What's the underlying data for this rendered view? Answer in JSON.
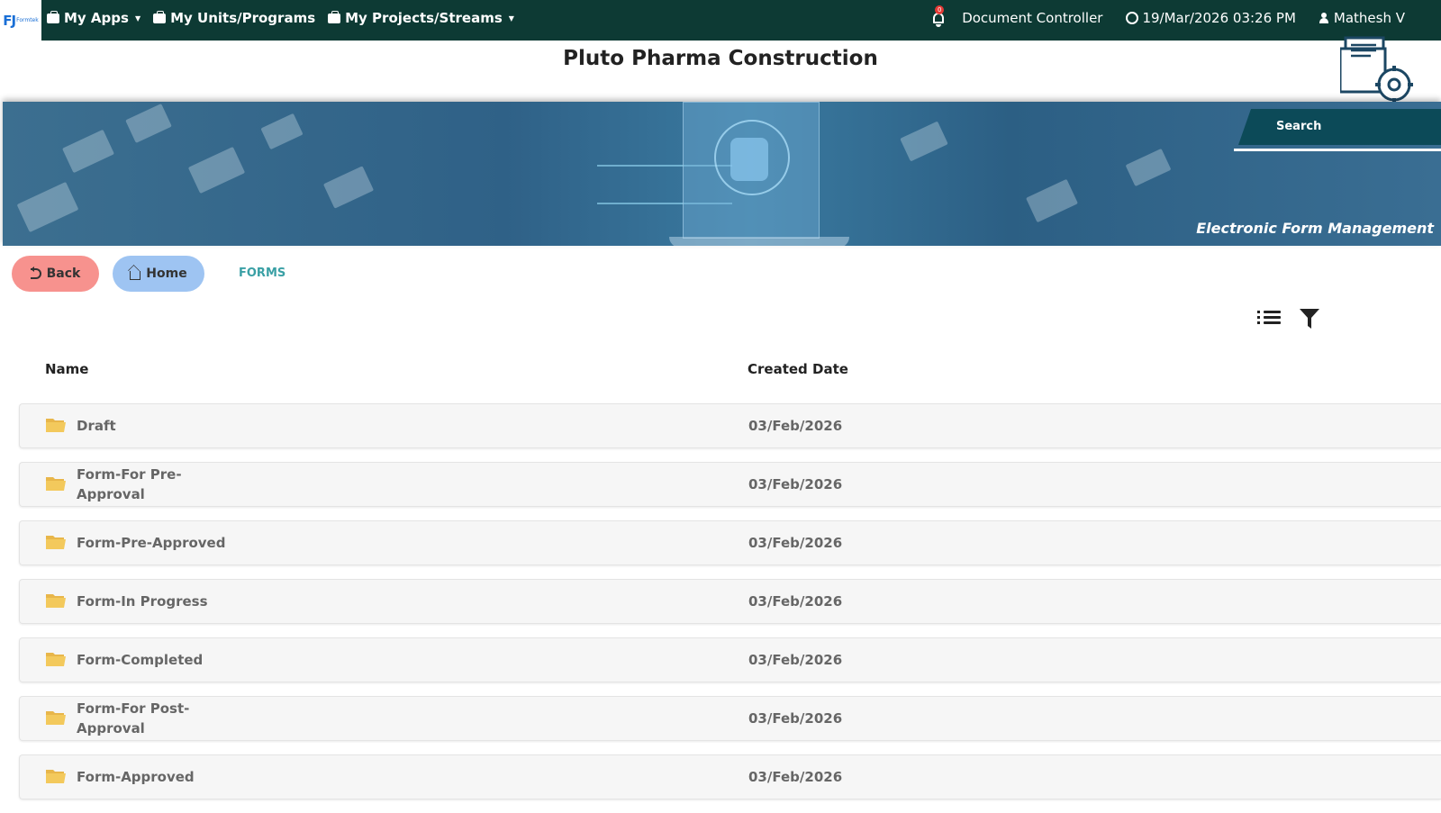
{
  "logo": {
    "text": "FJ",
    "sub": "Formtek"
  },
  "nav": {
    "items": [
      {
        "label": "My Apps"
      },
      {
        "label": "My Units/Programs"
      },
      {
        "label": "My Projects/Streams"
      }
    ],
    "notification_count": "0",
    "role": "Document Controller",
    "datetime": "19/Mar/2026 03:26 PM",
    "user": "Mathesh V"
  },
  "page": {
    "title": "Pluto Pharma Construction"
  },
  "banner": {
    "search_label": "Search",
    "caption": "Electronic Form Management"
  },
  "toolbar": {
    "back_label": "Back",
    "home_label": "Home",
    "breadcrumb": "FORMS"
  },
  "table": {
    "columns": [
      "Name",
      "Created Date"
    ],
    "rows": [
      {
        "name": "Draft",
        "date": "03/Feb/2026"
      },
      {
        "name": "Form-For Pre-Approval",
        "date": "03/Feb/2026"
      },
      {
        "name": "Form-Pre-Approved",
        "date": "03/Feb/2026"
      },
      {
        "name": "Form-In Progress",
        "date": "03/Feb/2026"
      },
      {
        "name": "Form-Completed",
        "date": "03/Feb/2026"
      },
      {
        "name": "Form-For Post-Approval",
        "date": "03/Feb/2026"
      },
      {
        "name": "Form-Approved",
        "date": "03/Feb/2026"
      }
    ]
  },
  "colors": {
    "topbar": "#0d3a34",
    "back": "#f7928e",
    "home": "#9ec4f2",
    "accent": "#3aa0a5",
    "folder": "#f3c95c"
  },
  "icons": [
    "briefcase-icon",
    "bell-icon",
    "clock-icon",
    "user-icon",
    "document-settings-icon",
    "undo-icon",
    "home-icon",
    "list-view-icon",
    "filter-icon",
    "folder-icon"
  ]
}
